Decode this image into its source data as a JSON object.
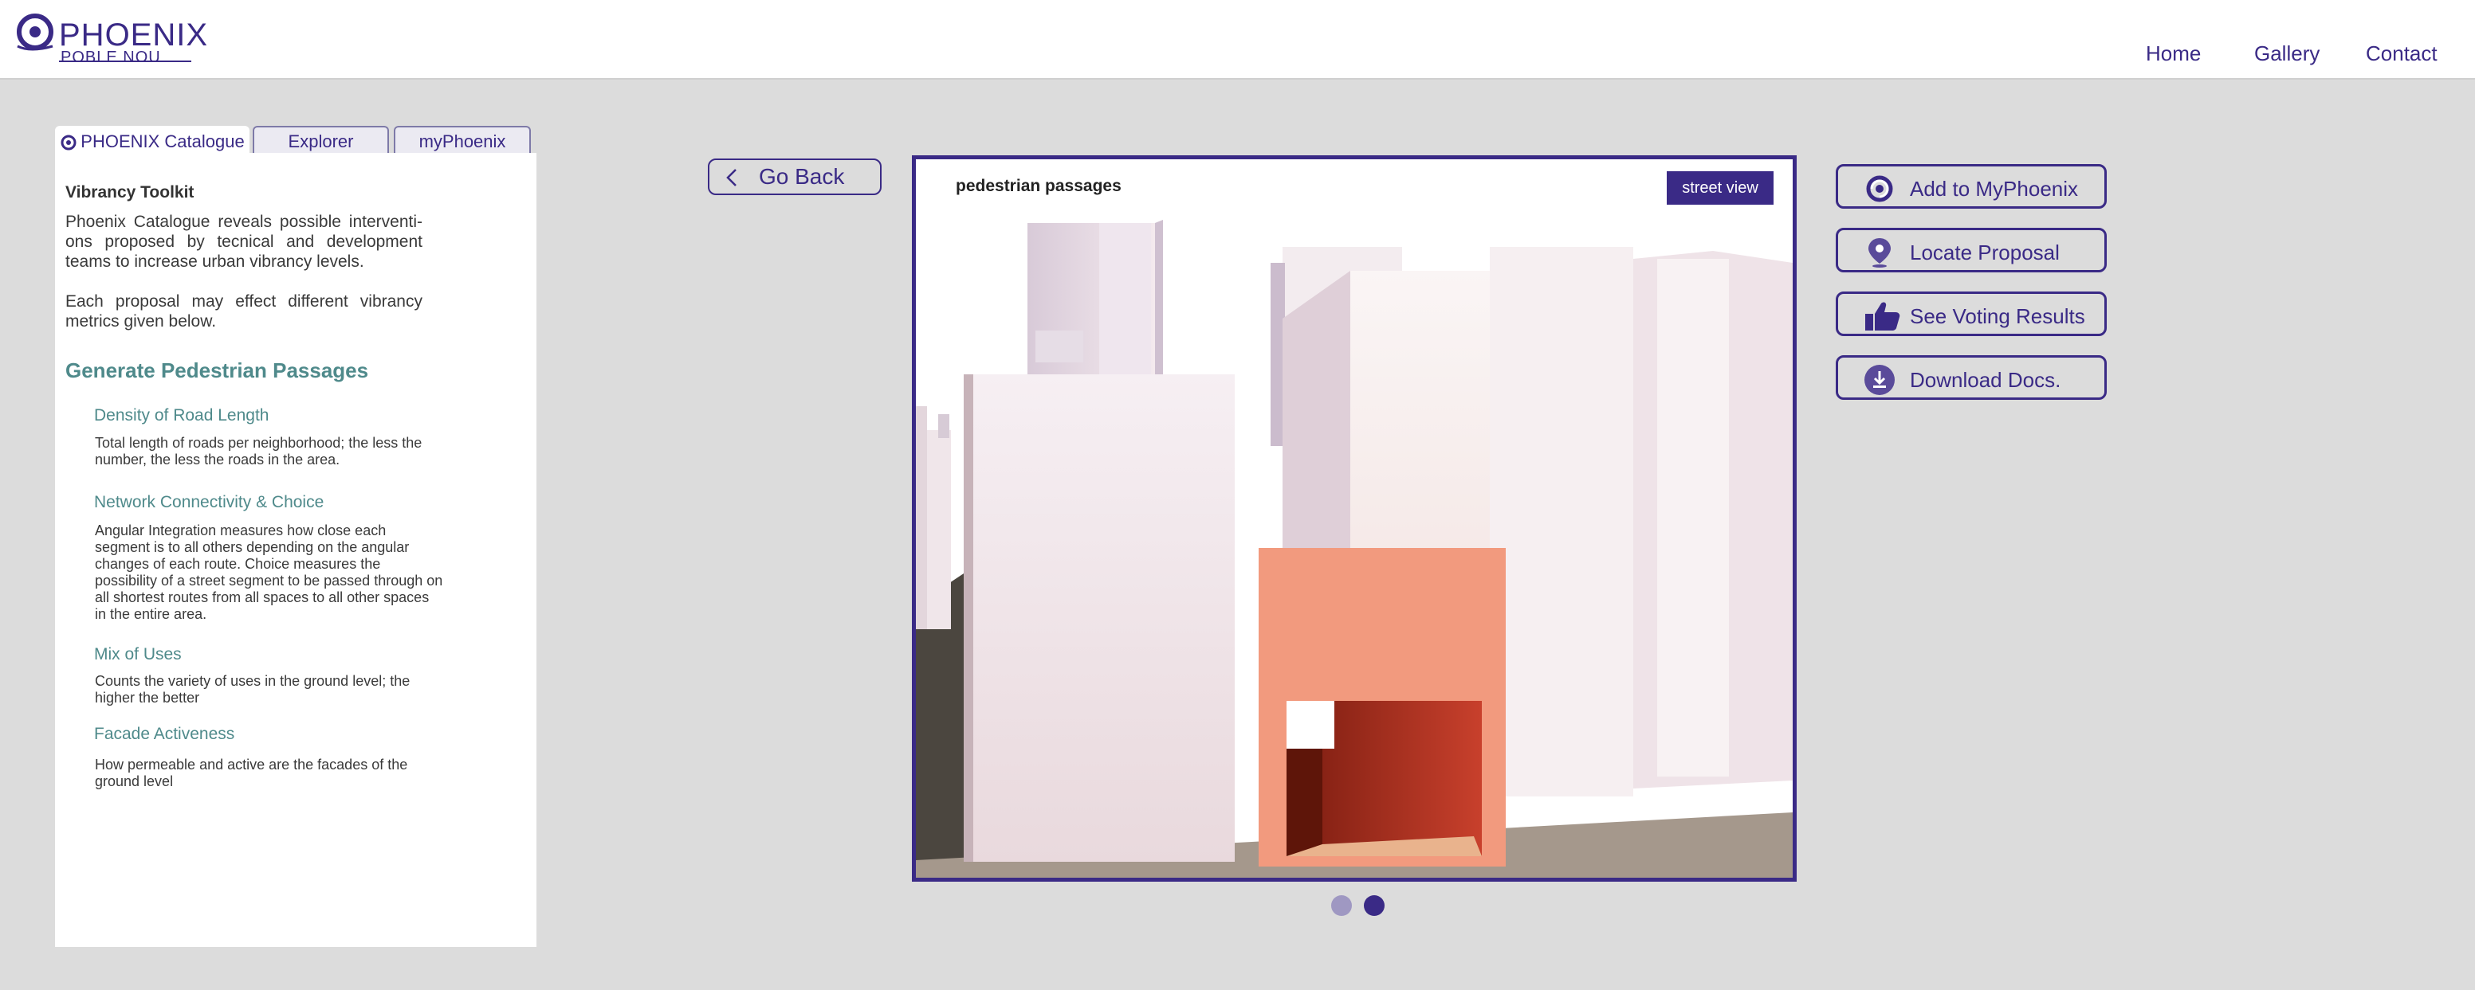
{
  "brand": {
    "title": "PHOENIX",
    "subtitle": "POBLE NOU"
  },
  "nav": [
    {
      "label": "Home"
    },
    {
      "label": "Gallery"
    },
    {
      "label": "Contact"
    }
  ],
  "tabs": [
    {
      "label": "PHOENIX Catalogue"
    },
    {
      "label": "Explorer"
    },
    {
      "label": "myPhoenix"
    }
  ],
  "panel": {
    "heading": "Vibrancy Toolkit",
    "intro1": "Phoenix Catalogue reveals possible interventi- ons proposed by tecnical and development teams to increase urban vibrancy levels.",
    "intro2": "Each proposal may effect different vibrancy metrics given below.",
    "proposal_title": "Generate Pedestrian Passages",
    "metrics": [
      {
        "name": "Density of Road Length",
        "desc": "Total length of roads per neighborhood; the less the number, the less the roads in the area."
      },
      {
        "name": "Network Connectivity & Choice",
        "desc": "Angular Integration measures how close each segment is to all others depending on the angular changes of each route. Choice measures the possibility of a street segment to be passed through on all shortest routes from all spaces to all other spaces in the entire area."
      },
      {
        "name": "Mix of Uses",
        "desc": "Counts the variety of uses in the ground level; the higher the better"
      },
      {
        "name": "Facade Activeness",
        "desc": "How permeable and active are the facades of the ground level"
      }
    ]
  },
  "go_back": "Go Back",
  "viewer": {
    "title": "pedestrian passages",
    "street_view": "street view",
    "slides": 2,
    "active_slide": 2
  },
  "actions": [
    {
      "label": "Add to MyPhoenix",
      "icon": "phoenix-logo-icon"
    },
    {
      "label": "Locate Proposal",
      "icon": "location-pin-icon"
    },
    {
      "label": "See Voting Results",
      "icon": "thumbs-up-icon"
    },
    {
      "label": "Download Docs.",
      "icon": "download-icon"
    }
  ],
  "colors": {
    "brand": "#3a2a86",
    "accent_teal": "#4f8a8b",
    "background": "#dcdcdc",
    "passage": "#f29a7e"
  }
}
